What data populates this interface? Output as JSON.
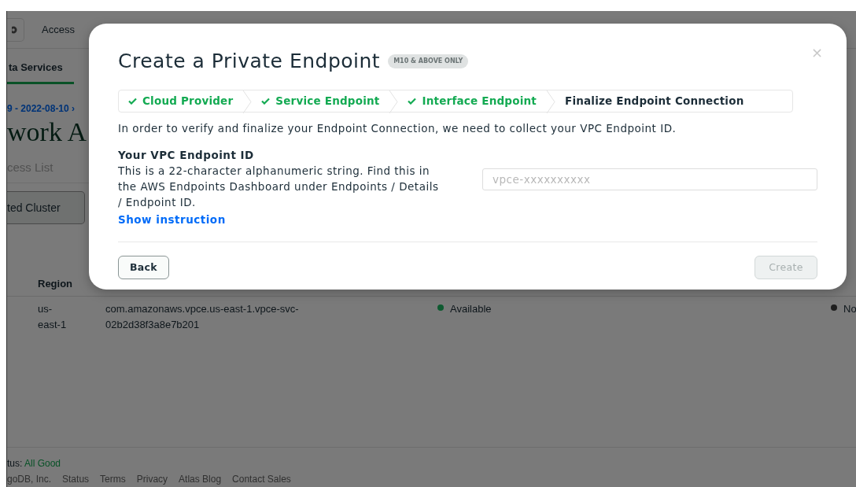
{
  "page": {
    "header": {
      "menu_label": "Access"
    },
    "tab": {
      "label": "ta Services",
      "selected": true
    },
    "breadcrumb": "9 - 2022-08-10 ›",
    "heading": "work A",
    "subtab": "cess List",
    "cluster_button": "ted Cluster",
    "table": {
      "columns": [
        "Region"
      ],
      "rows": [
        {
          "region": "us-east-1",
          "endpoint": "com.amazonaws.vpce.us-east-1.vpce-svc-02b2d38f3a8e7b201",
          "status": {
            "label": "Available",
            "color": "#0e5a30"
          },
          "status_2": {
            "label": "No",
            "color": "#1f1f1f"
          }
        }
      ]
    },
    "footer": {
      "status_label": "tus:",
      "status_value": "All Good",
      "links": [
        "goDB, Inc.",
        "Status",
        "Terms",
        "Privacy",
        "Atlas Blog",
        "Contact Sales"
      ]
    }
  },
  "modal": {
    "title": "Create a Private Endpoint",
    "badge": "M10 & ABOVE ONLY",
    "close": "×",
    "steps": [
      {
        "label": "Cloud Provider",
        "done": true
      },
      {
        "label": "Service Endpoint",
        "done": true
      },
      {
        "label": "Interface Endpoint",
        "done": true
      },
      {
        "label": "Finalize Endpoint Connection",
        "done": false
      }
    ],
    "intro": "In order to verify and finalize your Endpoint Connection, we need to collect your VPC Endpoint ID.",
    "field_label": "Your VPC Endpoint ID",
    "description": "This is a 22-character alphanumeric string. Find this in the AWS Endpoints Dashboard under Endpoints / Details / Endpoint ID.",
    "link": "Show instruction",
    "placeholder": "vpce-xxxxxxxxxx",
    "buttons": [
      {
        "label": "Back",
        "disabled": false
      },
      {
        "label": "Create",
        "disabled": true
      }
    ]
  }
}
